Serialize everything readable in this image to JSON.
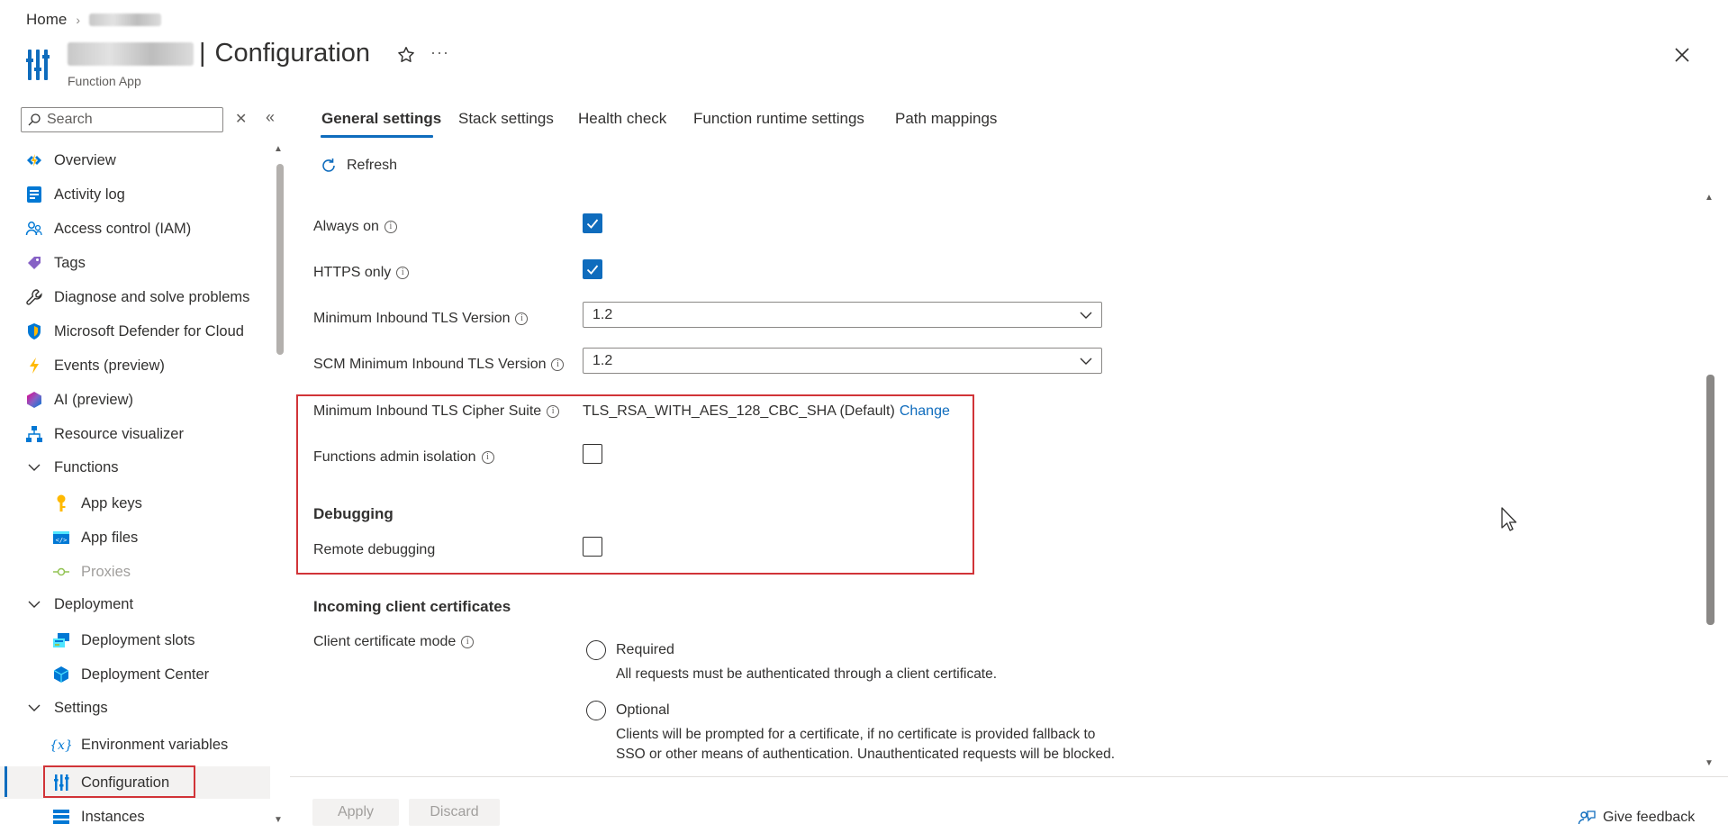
{
  "breadcrumb": {
    "home": "Home"
  },
  "header": {
    "title": "Configuration",
    "subtitle": "Function App",
    "more_label": "···"
  },
  "sidebar": {
    "search_placeholder": "Search",
    "items": [
      {
        "label": "Overview",
        "icon": "overview-icon"
      },
      {
        "label": "Activity log",
        "icon": "activity-log-icon"
      },
      {
        "label": "Access control (IAM)",
        "icon": "people-icon"
      },
      {
        "label": "Tags",
        "icon": "tag-icon"
      },
      {
        "label": "Diagnose and solve problems",
        "icon": "wrench-icon"
      },
      {
        "label": "Microsoft Defender for Cloud",
        "icon": "shield-icon"
      },
      {
        "label": "Events (preview)",
        "icon": "lightning-icon"
      },
      {
        "label": "AI (preview)",
        "icon": "ai-icon"
      },
      {
        "label": "Resource visualizer",
        "icon": "hierarchy-icon"
      },
      {
        "label": "Functions",
        "icon": "chevron-down-icon"
      },
      {
        "label": "App keys",
        "icon": "key-icon"
      },
      {
        "label": "App files",
        "icon": "code-file-icon"
      },
      {
        "label": "Proxies",
        "icon": "proxy-icon"
      },
      {
        "label": "Deployment",
        "icon": "chevron-down-icon"
      },
      {
        "label": "Deployment slots",
        "icon": "slots-icon"
      },
      {
        "label": "Deployment Center",
        "icon": "cube-icon"
      },
      {
        "label": "Settings",
        "icon": "chevron-down-icon"
      },
      {
        "label": "Environment variables",
        "icon": "variable-icon"
      },
      {
        "label": "Configuration",
        "icon": "config-bars-icon"
      },
      {
        "label": "Instances",
        "icon": "instances-icon"
      }
    ]
  },
  "tabs": [
    {
      "label": "General settings",
      "active": true
    },
    {
      "label": "Stack settings"
    },
    {
      "label": "Health check"
    },
    {
      "label": "Function runtime settings"
    },
    {
      "label": "Path mappings"
    }
  ],
  "toolbar": {
    "refresh_label": "Refresh"
  },
  "settings": {
    "always_on": {
      "label": "Always on",
      "checked": true
    },
    "https_only": {
      "label": "HTTPS only",
      "checked": true
    },
    "min_tls": {
      "label": "Minimum Inbound TLS Version",
      "value": "1.2"
    },
    "scm_min_tls": {
      "label": "SCM Minimum Inbound TLS Version",
      "value": "1.2"
    },
    "cipher_suite": {
      "label": "Minimum Inbound TLS Cipher Suite",
      "value": "TLS_RSA_WITH_AES_128_CBC_SHA (Default)",
      "link": "Change"
    },
    "admin_isolation": {
      "label": "Functions admin isolation",
      "checked": false
    },
    "debugging_heading": "Debugging",
    "remote_debugging": {
      "label": "Remote debugging",
      "checked": false
    },
    "certs_heading": "Incoming client certificates",
    "client_cert_mode": {
      "label": "Client certificate mode",
      "options": [
        {
          "label": "Required",
          "desc": "All requests must be authenticated through a client certificate."
        },
        {
          "label": "Optional",
          "desc": "Clients will be prompted for a certificate, if no certificate is provided fallback to SSO or other means of authentication. Unauthenticated requests will be blocked."
        }
      ]
    }
  },
  "footer": {
    "apply_label": "Apply",
    "discard_label": "Discard",
    "feedback_label": "Give feedback"
  },
  "colors": {
    "accent": "#0f6cbd",
    "highlight": "#d13438"
  }
}
